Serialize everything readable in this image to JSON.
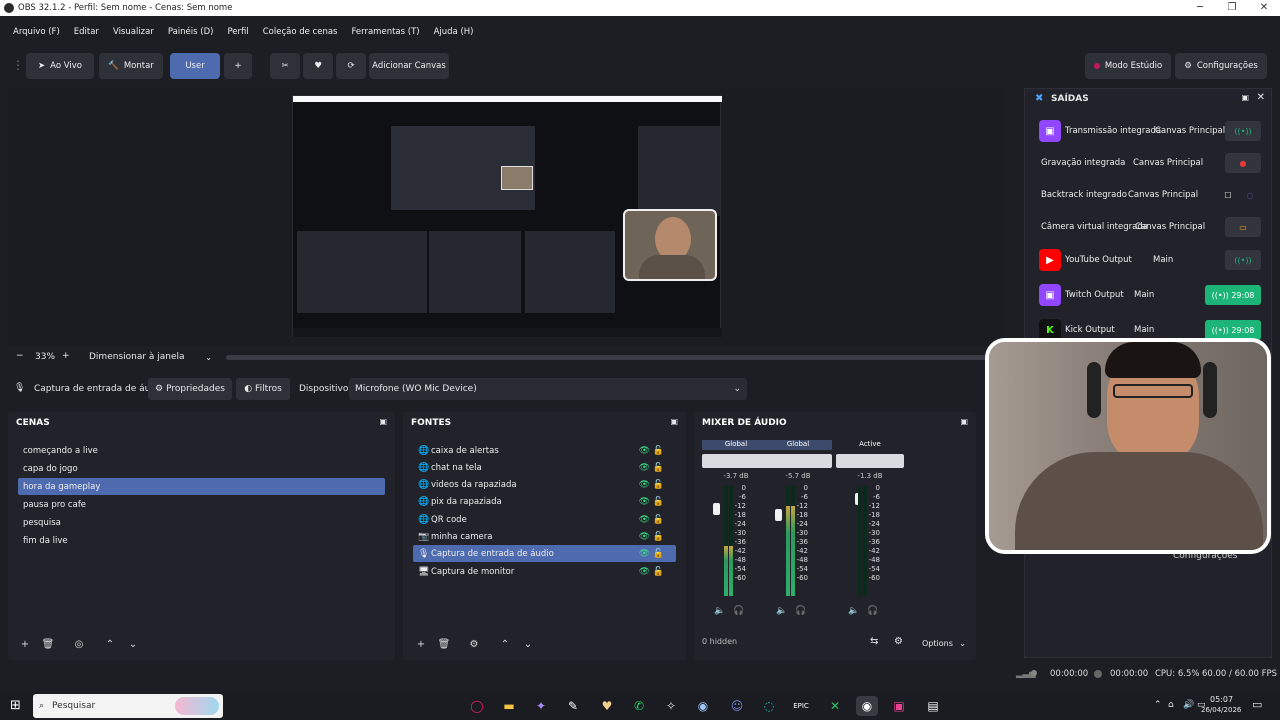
{
  "window": {
    "title": "OBS 32.1.2 - Perfil: Sem nome - Cenas: Sem nome"
  },
  "menu": [
    "Arquivo (F)",
    "Editar",
    "Visualizar",
    "Painéis (D)",
    "Perfil",
    "Coleção de cenas",
    "Ferramentas (T)",
    "Ajuda (H)"
  ],
  "toolbar": {
    "live": "Ao Vivo",
    "build": "Montar",
    "user": "User",
    "plus": "+",
    "add_canvas": "Adicionar Canvas",
    "studio_mode": "Modo Estúdio",
    "settings": "Configurações"
  },
  "preview": {
    "zoom": "33%",
    "scale_mode": "Dimensionar à janela"
  },
  "context": {
    "source_name": "Captura de entrada de áudio",
    "properties": "Propriedades",
    "filters": "Filtros",
    "device_label": "Dispositivo",
    "device_value": "Microfone (WO Mic Device)"
  },
  "scenes": {
    "title": "CENAS",
    "items": [
      "começando a live",
      "capa do jogo",
      "hora da gameplay",
      "pausa pro cafe",
      "pesquisa",
      "fim da live"
    ],
    "selected_index": 2
  },
  "sources": {
    "title": "FONTES",
    "items": [
      {
        "label": "caixa de alertas",
        "icon": "globe-icon"
      },
      {
        "label": "chat na tela",
        "icon": "globe-icon"
      },
      {
        "label": "videos da rapaziada",
        "icon": "globe-icon"
      },
      {
        "label": "pix da rapaziada",
        "icon": "globe-icon"
      },
      {
        "label": "QR code",
        "icon": "globe-icon"
      },
      {
        "label": "minha camera",
        "icon": "camera-icon"
      },
      {
        "label": "Captura de entrada de áudio",
        "icon": "mic-icon"
      },
      {
        "label": "Captura de monitor",
        "icon": "monitor-icon"
      }
    ],
    "selected_index": 6
  },
  "mixer": {
    "title": "MIXER DE ÁUDIO",
    "strips": [
      {
        "header": "Global",
        "db": "-3.7 dB",
        "level": 0.45
      },
      {
        "header": "Global",
        "db": "-5.7 dB",
        "level": 0.82
      },
      {
        "header": "Active",
        "db": "-1.3 dB",
        "level": 0.0
      }
    ],
    "scale": [
      "0",
      "-6",
      "-12",
      "-18",
      "-24",
      "-30",
      "-36",
      "-42",
      "-48",
      "-54",
      "-60"
    ],
    "hidden": "0 hidden",
    "options": "Options"
  },
  "outputs": {
    "title": "SAÍDAS",
    "rows": [
      {
        "label": "Transmissão integrada",
        "canvas": "Canvas Principal",
        "badge": "twitch",
        "badge_color": "#9146ff",
        "status": ""
      },
      {
        "label": "Gravação integrada",
        "canvas": "Canvas Principal",
        "badge": "",
        "badge_color": "",
        "status": ""
      },
      {
        "label": "Backtrack integrado",
        "canvas": "Canvas Principal",
        "badge": "",
        "badge_color": "",
        "status": ""
      },
      {
        "label": "Câmera virtual integrada",
        "canvas": "Canvas Principal",
        "badge": "",
        "badge_color": "",
        "status": ""
      },
      {
        "label": "YouTube Output",
        "canvas": "Main",
        "badge": "youtube",
        "badge_color": "#ff0000",
        "status": ""
      },
      {
        "label": "Twitch Output",
        "canvas": "Main",
        "badge": "twitch",
        "badge_color": "#9146ff",
        "status": "29:08"
      },
      {
        "label": "Kick Output",
        "canvas": "Main",
        "badge": "kick",
        "badge_color": "#53fc18",
        "status": "29:08"
      }
    ],
    "config_label": "Configurações"
  },
  "status": {
    "time1": "00:00:00",
    "time2": "00:00:00",
    "cpu": "CPU: 6.5%",
    "fps": "60.00 / 60.00 FPS"
  },
  "taskbar": {
    "search": "Pesquisar",
    "clock_time": "05:07",
    "clock_date": "26/04/2026"
  },
  "colors": {
    "accent": "#4f6bb0",
    "live_green": "#1db577",
    "eye_green": "#3ddc84"
  }
}
